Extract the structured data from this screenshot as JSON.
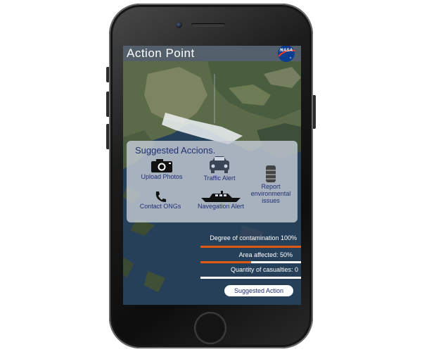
{
  "app": {
    "title": "Action Point",
    "logo_text": "NASA"
  },
  "panel": {
    "title": "Suggested Accions.",
    "actions": [
      {
        "label": "Upload Photos",
        "icon": "camera-icon"
      },
      {
        "label": "Traffic Alert",
        "icon": "car-icon"
      },
      {
        "label": "Report environmental issues",
        "icon": "barrel-icon"
      },
      {
        "label": "Contact ONGs",
        "icon": "phone-icon"
      },
      {
        "label": "Navegation Alert",
        "icon": "ship-icon"
      }
    ]
  },
  "metrics": [
    {
      "label": "Degree of contamination 100%",
      "percent": 100,
      "color": "#e05a12"
    },
    {
      "label": "Area affected: 50%",
      "percent": 50,
      "color": "#e05a12"
    },
    {
      "label": "Quantity of casualties: 0",
      "percent": 0,
      "color": "#e05a12"
    }
  ],
  "suggest_button": "Suggested Action",
  "colors": {
    "accent_text": "#1f2f73",
    "bar_fill": "#e05a12",
    "panel_bg": "#c4ccd6"
  }
}
